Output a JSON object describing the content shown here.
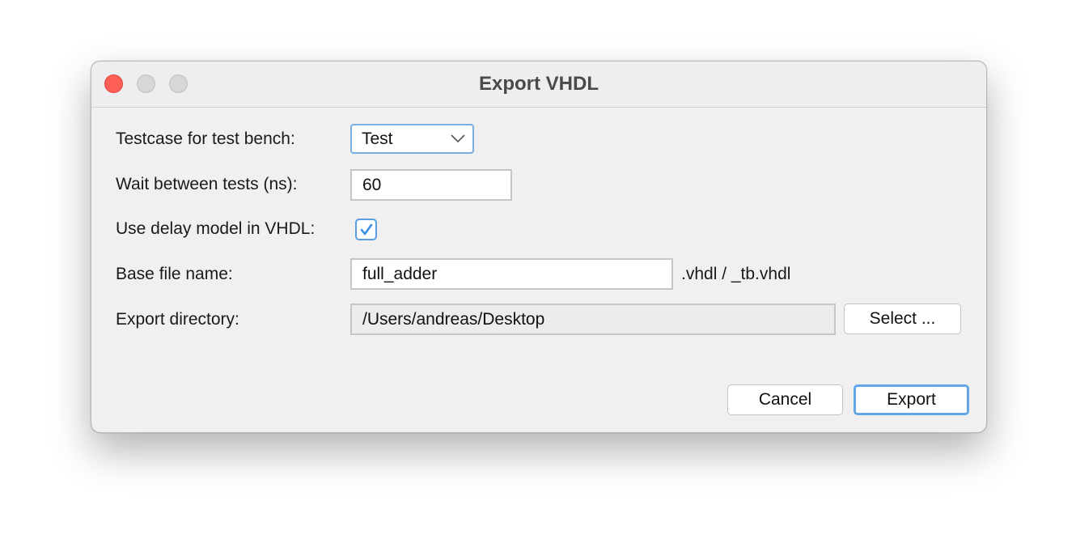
{
  "window": {
    "title": "Export VHDL"
  },
  "form": {
    "testcase_label": "Testcase for test bench:",
    "testcase_value": "Test",
    "wait_label": "Wait between tests (ns):",
    "wait_value": "60",
    "delay_label": "Use delay model in VHDL:",
    "delay_checked": true,
    "basename_label": "Base file name:",
    "basename_value": "full_adder",
    "basename_suffix": ".vhdl / _tb.vhdl",
    "directory_label": "Export directory:",
    "directory_value": "/Users/andreas/Desktop",
    "select_label": "Select ..."
  },
  "buttons": {
    "cancel": "Cancel",
    "export": "Export"
  },
  "colors": {
    "accent": "#5a9de0",
    "close": "#fe5f57"
  }
}
